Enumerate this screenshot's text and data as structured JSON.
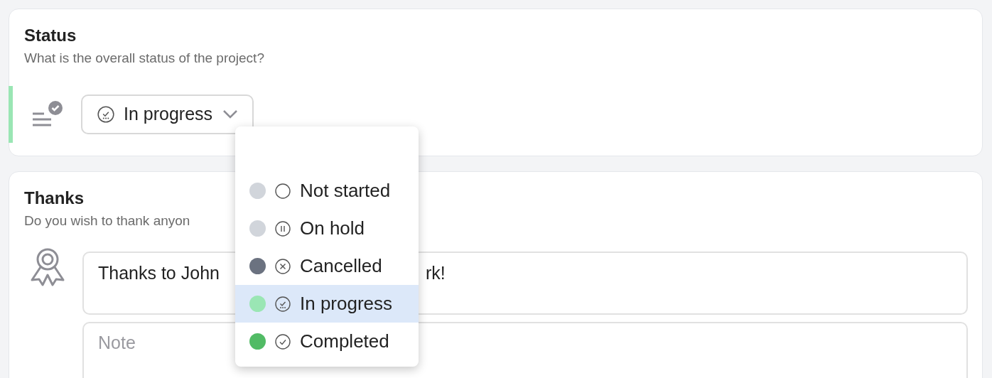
{
  "status_card": {
    "title": "Status",
    "subtitle": "What is the overall status of the project?",
    "select": {
      "value": "In progress",
      "expanded": true
    }
  },
  "thanks_card": {
    "title": "Thanks",
    "subtitle": "Do you wish to thank anyon",
    "field": {
      "value_start": "Thanks to John",
      "value_end": "rk!"
    },
    "note": {
      "placeholder": "Note"
    }
  },
  "menu": [
    {
      "label": "Not started",
      "kind": "empty",
      "color": "#d1d5db",
      "selected": false
    },
    {
      "label": "On hold",
      "kind": "pause",
      "color": "#d1d5db",
      "selected": false
    },
    {
      "label": "Cancelled",
      "kind": "cross",
      "color": "#6b7280",
      "selected": false
    },
    {
      "label": "In progress",
      "kind": "progress",
      "color": "#9ae6b4",
      "selected": true
    },
    {
      "label": "Completed",
      "kind": "check",
      "color": "#51bb65",
      "selected": false
    }
  ]
}
